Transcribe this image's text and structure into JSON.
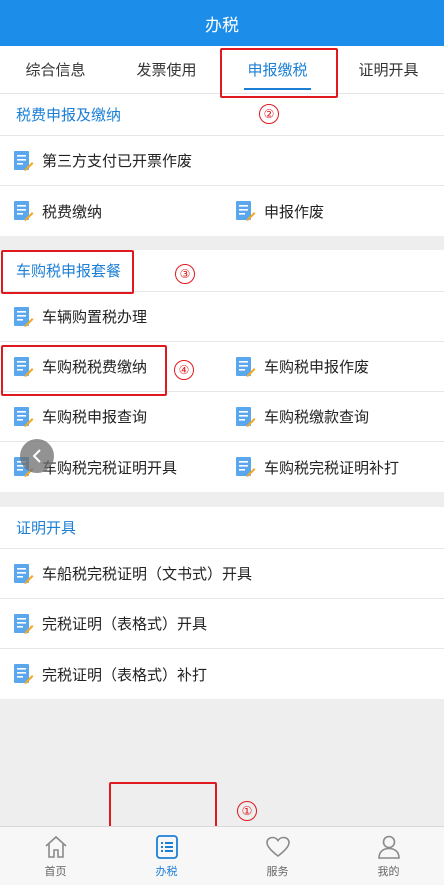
{
  "header": {
    "title": "办税"
  },
  "tabs": [
    {
      "label": "综合信息"
    },
    {
      "label": "发票使用"
    },
    {
      "label": "申报缴税"
    },
    {
      "label": "证明开具"
    }
  ],
  "sections": [
    {
      "title": "税费申报及缴纳",
      "rows": [
        [
          "第三方支付已开票作废"
        ],
        [
          "税费缴纳",
          "申报作废"
        ]
      ]
    },
    {
      "title": "车购税申报套餐",
      "rows": [
        [
          "车辆购置税办理"
        ],
        [
          "车购税税费缴纳",
          "车购税申报作废"
        ],
        [
          "车购税申报查询",
          "车购税缴款查询"
        ],
        [
          "车购税完税证明开具",
          "车购税完税证明补打"
        ]
      ]
    },
    {
      "title": "证明开具",
      "rows": [
        [
          "车船税完税证明（文书式）开具"
        ],
        [
          "完税证明（表格式）开具"
        ],
        [
          "完税证明（表格式）补打"
        ]
      ]
    }
  ],
  "annotations": [
    "①",
    "②",
    "③",
    "④"
  ],
  "bottom_nav": [
    {
      "label": "首页",
      "icon": "home-icon"
    },
    {
      "label": "办税",
      "icon": "list-icon"
    },
    {
      "label": "服务",
      "icon": "heart-icon"
    },
    {
      "label": "我的",
      "icon": "user-icon"
    }
  ],
  "colors": {
    "primary": "#1c8de8",
    "annotation": "#e0191f"
  }
}
